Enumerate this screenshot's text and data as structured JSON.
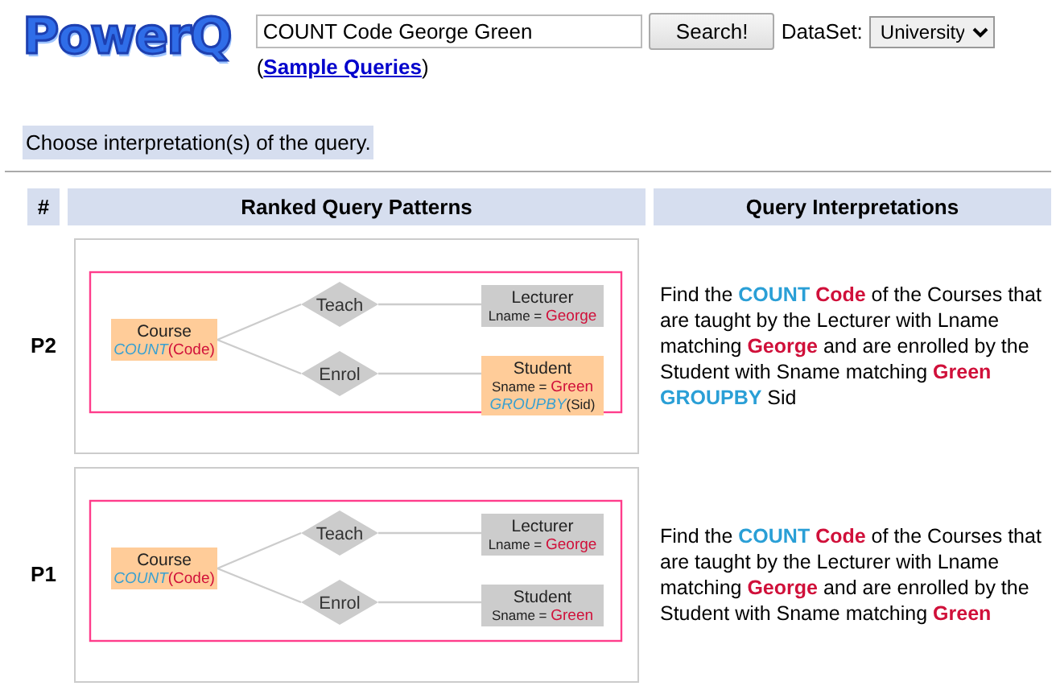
{
  "logo": "PowerQ",
  "search": {
    "value": "COUNT Code George Green",
    "button": "Search!"
  },
  "dataset": {
    "label": "DataSet:",
    "value": "University"
  },
  "sample_link": {
    "open": "(",
    "label": "Sample Queries",
    "close": ")"
  },
  "instruction": "Choose interpretation(s) of the query.",
  "table": {
    "columns": [
      "#",
      "Ranked Query Patterns",
      "Query Interpretations"
    ],
    "rows": [
      {
        "rank": "P2",
        "pattern": {
          "root": {
            "highlighted": true,
            "lines": [
              [
                {
                  "kind": "plain",
                  "text": "Course"
                }
              ],
              [
                {
                  "kind": "func",
                  "text": "COUNT"
                },
                {
                  "kind": "value",
                  "text": "(Code)"
                }
              ]
            ]
          },
          "branches": [
            {
              "relation": "Teach",
              "entity": {
                "highlighted": false,
                "lines": [
                  [
                    {
                      "kind": "plain",
                      "text": "Lecturer"
                    }
                  ],
                  [
                    {
                      "kind": "small",
                      "text": "Lname = "
                    },
                    {
                      "kind": "value",
                      "text": "George"
                    }
                  ]
                ]
              }
            },
            {
              "relation": "Enrol",
              "entity": {
                "highlighted": true,
                "lines": [
                  [
                    {
                      "kind": "plain",
                      "text": "Student"
                    }
                  ],
                  [
                    {
                      "kind": "small",
                      "text": "Sname = "
                    },
                    {
                      "kind": "value",
                      "text": "Green"
                    }
                  ],
                  [
                    {
                      "kind": "func",
                      "text": "GROUPBY"
                    },
                    {
                      "kind": "small",
                      "text": "(Sid)"
                    }
                  ]
                ]
              }
            }
          ]
        },
        "interpretation": [
          {
            "kind": "plain",
            "text": "Find the "
          },
          {
            "kind": "func",
            "text": "COUNT"
          },
          {
            "kind": "value",
            "text": " Code"
          },
          {
            "kind": "plain",
            "text": " of the Courses that are taught by the Lecturer with Lname matching "
          },
          {
            "kind": "value",
            "text": "George"
          },
          {
            "kind": "plain",
            "text": " and are enrolled by the Student with Sname matching "
          },
          {
            "kind": "value",
            "text": "Green"
          },
          {
            "kind": "func",
            "text": " GROUPBY"
          },
          {
            "kind": "plain",
            "text": " Sid"
          }
        ]
      },
      {
        "rank": "P1",
        "pattern": {
          "root": {
            "highlighted": true,
            "lines": [
              [
                {
                  "kind": "plain",
                  "text": "Course"
                }
              ],
              [
                {
                  "kind": "func",
                  "text": "COUNT"
                },
                {
                  "kind": "value",
                  "text": "(Code)"
                }
              ]
            ]
          },
          "branches": [
            {
              "relation": "Teach",
              "entity": {
                "highlighted": false,
                "lines": [
                  [
                    {
                      "kind": "plain",
                      "text": "Lecturer"
                    }
                  ],
                  [
                    {
                      "kind": "small",
                      "text": "Lname = "
                    },
                    {
                      "kind": "value",
                      "text": "George"
                    }
                  ]
                ]
              }
            },
            {
              "relation": "Enrol",
              "entity": {
                "highlighted": false,
                "lines": [
                  [
                    {
                      "kind": "plain",
                      "text": "Student"
                    }
                  ],
                  [
                    {
                      "kind": "small",
                      "text": "Sname = "
                    },
                    {
                      "kind": "value",
                      "text": "Green"
                    }
                  ]
                ]
              }
            }
          ]
        },
        "interpretation": [
          {
            "kind": "plain",
            "text": "Find the "
          },
          {
            "kind": "func",
            "text": "COUNT"
          },
          {
            "kind": "value",
            "text": " Code"
          },
          {
            "kind": "plain",
            "text": " of the Courses that are taught by the Lecturer with Lname matching "
          },
          {
            "kind": "value",
            "text": "George"
          },
          {
            "kind": "plain",
            "text": " and are enrolled by the Student with Sname matching "
          },
          {
            "kind": "value",
            "text": "Green"
          }
        ]
      }
    ]
  }
}
